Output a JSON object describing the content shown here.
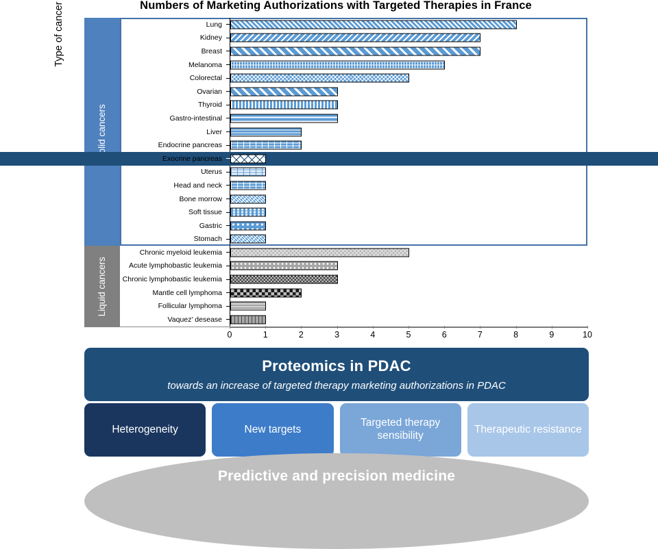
{
  "chart_data": {
    "type": "bar",
    "orientation": "horizontal",
    "title": "Numbers of Marketing Authorizations with Targeted Therapies in France",
    "xlabel": "",
    "ylabel": "Type of cancer",
    "xlim": [
      0,
      10
    ],
    "xticks": [
      "0",
      "1",
      "2",
      "3",
      "4",
      "5",
      "6",
      "7",
      "8",
      "9",
      "10"
    ],
    "grid": false,
    "legend": "none",
    "groups": [
      {
        "name": "Solid cancers",
        "color": "#4e81bd",
        "categories": [
          "Lung",
          "Kidney",
          "Breast",
          "Melanoma",
          "Colorectal",
          "Ovarian",
          "Thyroid",
          "Gastro-intestinal",
          "Liver",
          "Endocrine pancreas",
          "Exocrine pancreas",
          "Uterus",
          "Head and neck",
          "Bone morrow",
          "Soft tissue",
          "Gastric",
          "Stomach"
        ],
        "values": [
          8,
          7,
          7,
          6,
          5,
          3,
          3,
          3,
          2,
          2,
          1,
          1,
          1,
          1,
          1,
          1,
          1
        ],
        "patterns": [
          "p-diag-narrow",
          "p-diag-back",
          "p-diag-wide",
          "p-grid-small",
          "p-diag-cross",
          "p-diag-wide",
          "p-vert",
          "p-horz",
          "p-horz-thin",
          "p-brick",
          "p-diamond",
          "p-brick-light",
          "p-brick",
          "p-confetti",
          "p-dash",
          "p-dots-sparse",
          "p-confetti"
        ],
        "highlighted": "Exocrine pancreas"
      },
      {
        "name": "Liquid cancers",
        "color": "#808080",
        "categories": [
          "Chronic myeloid leukemia",
          "Acute lymphobastic leukemia",
          "Chronic lymphobastic leukemia",
          "Mantle cell lymphoma",
          "Follicular lymphoma",
          "Vaquez' desease"
        ],
        "values": [
          5,
          3,
          3,
          2,
          1,
          1
        ],
        "patterns": [
          "p-check-dark",
          "p-dots-gray",
          "p-check-gray",
          "p-check-big",
          "p-horz-gray",
          "p-vert-gray"
        ]
      }
    ]
  },
  "axis": {
    "y_title": "Type of cancer"
  },
  "banner": {
    "title": "Proteomics in PDAC",
    "subtitle": "towards an increase of targeted therapy marketing authorizations in PDAC",
    "color": "#1f4e79"
  },
  "cards": [
    {
      "label": "Heterogeneity",
      "color": "#1a365f"
    },
    {
      "label": "New targets",
      "color": "#3d7cc9"
    },
    {
      "label": "Targeted therapy sensibility",
      "color": "#7aa6d8"
    },
    {
      "label": "Therapeutic resistance",
      "color": "#a8c6e8"
    }
  ],
  "footer": {
    "label": "Predictive and precision medicine",
    "color": "#bfbfbf"
  }
}
